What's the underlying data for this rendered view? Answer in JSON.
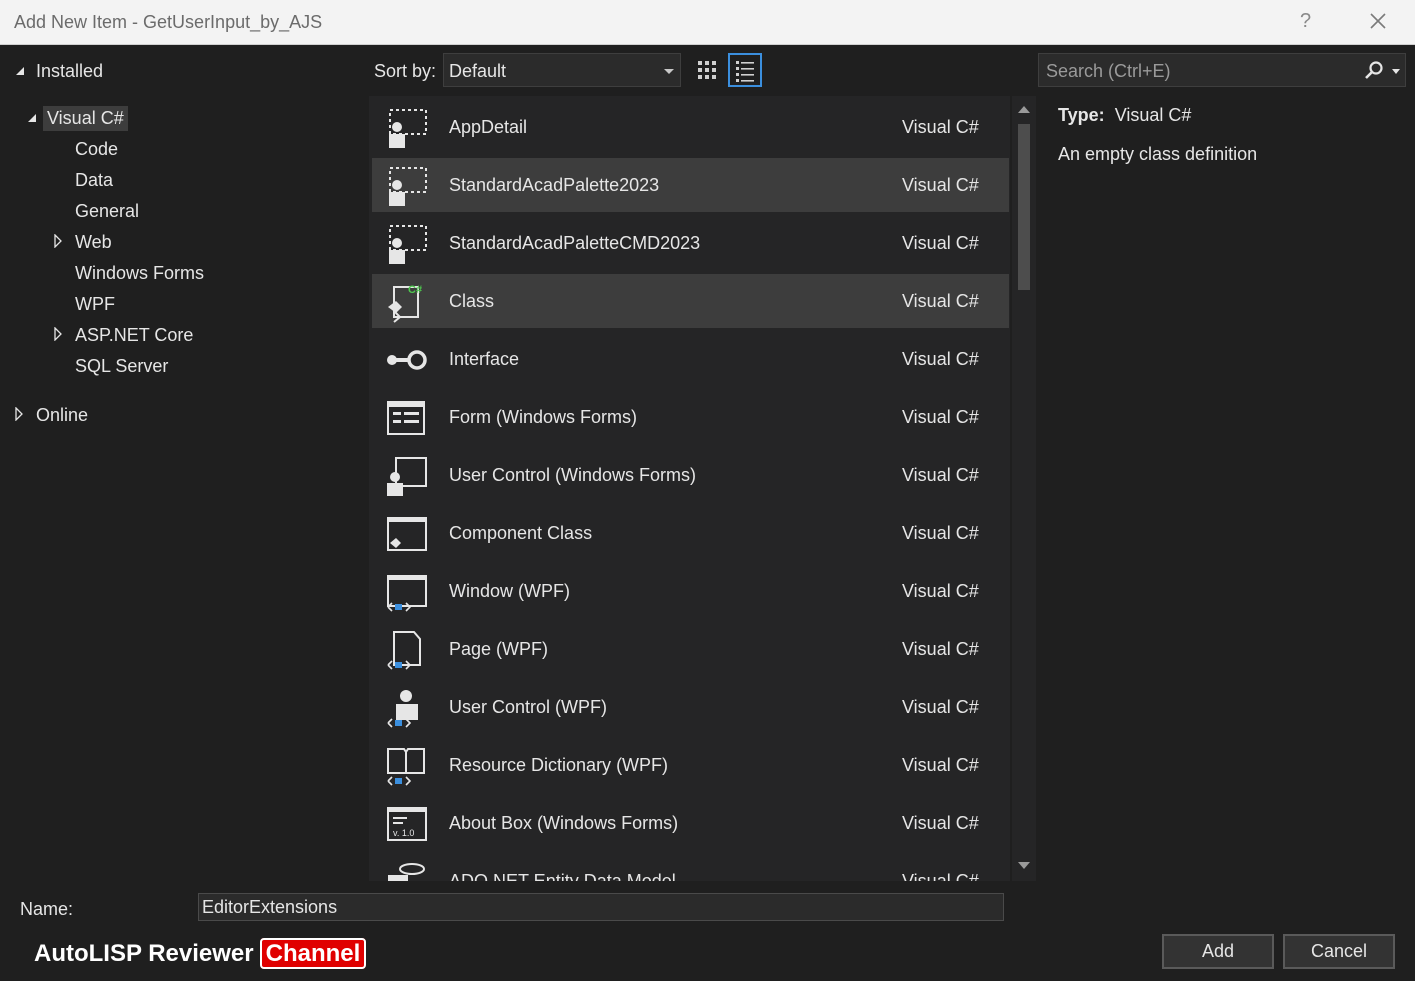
{
  "window": {
    "title": "Add New Item - GetUserInput_by_AJS",
    "help": "?"
  },
  "tree": {
    "installed": "Installed",
    "visual_csharp": "Visual C#",
    "children": [
      "Code",
      "Data",
      "General",
      "Web",
      "Windows Forms",
      "WPF",
      "ASP.NET Core",
      "SQL Server"
    ],
    "online": "Online"
  },
  "toolbar": {
    "sort_label": "Sort by:",
    "sort_value": "Default"
  },
  "search": {
    "placeholder": "Search (Ctrl+E)"
  },
  "items": [
    {
      "name": "AppDetail",
      "type": "Visual C#",
      "icon": "palette-icon"
    },
    {
      "name": "StandardAcadPalette2023",
      "type": "Visual C#",
      "icon": "palette-icon"
    },
    {
      "name": "StandardAcadPaletteCMD2023",
      "type": "Visual C#",
      "icon": "palette-icon"
    },
    {
      "name": "Class",
      "type": "Visual C#",
      "icon": "class-icon"
    },
    {
      "name": "Interface",
      "type": "Visual C#",
      "icon": "interface-icon"
    },
    {
      "name": "Form (Windows Forms)",
      "type": "Visual C#",
      "icon": "form-icon"
    },
    {
      "name": "User Control (Windows Forms)",
      "type": "Visual C#",
      "icon": "user-control-icon"
    },
    {
      "name": "Component Class",
      "type": "Visual C#",
      "icon": "component-icon"
    },
    {
      "name": "Window (WPF)",
      "type": "Visual C#",
      "icon": "window-icon"
    },
    {
      "name": "Page (WPF)",
      "type": "Visual C#",
      "icon": "page-icon"
    },
    {
      "name": "User Control (WPF)",
      "type": "Visual C#",
      "icon": "wpf-user-control-icon"
    },
    {
      "name": "Resource Dictionary (WPF)",
      "type": "Visual C#",
      "icon": "resource-dictionary-icon"
    },
    {
      "name": "About Box (Windows Forms)",
      "type": "Visual C#",
      "icon": "about-box-icon"
    },
    {
      "name": "ADO.NET Entity Data Model",
      "type": "Visual C#",
      "icon": "entity-model-icon"
    }
  ],
  "details": {
    "type_label": "Type:",
    "type_value": "Visual C#",
    "description": "An empty class definition"
  },
  "bottom": {
    "name_label": "Name:",
    "name_value": "EditorExtensions",
    "add_label": "Add",
    "cancel_label": "Cancel"
  },
  "watermark": {
    "text": "AutoLISP Reviewer",
    "badge": "Channel"
  },
  "colors": {
    "background": "#1f1f1f",
    "list_bg": "#252526",
    "selection": "#3d3d3d",
    "accent": "#3b8fde",
    "badge": "#e00000"
  }
}
